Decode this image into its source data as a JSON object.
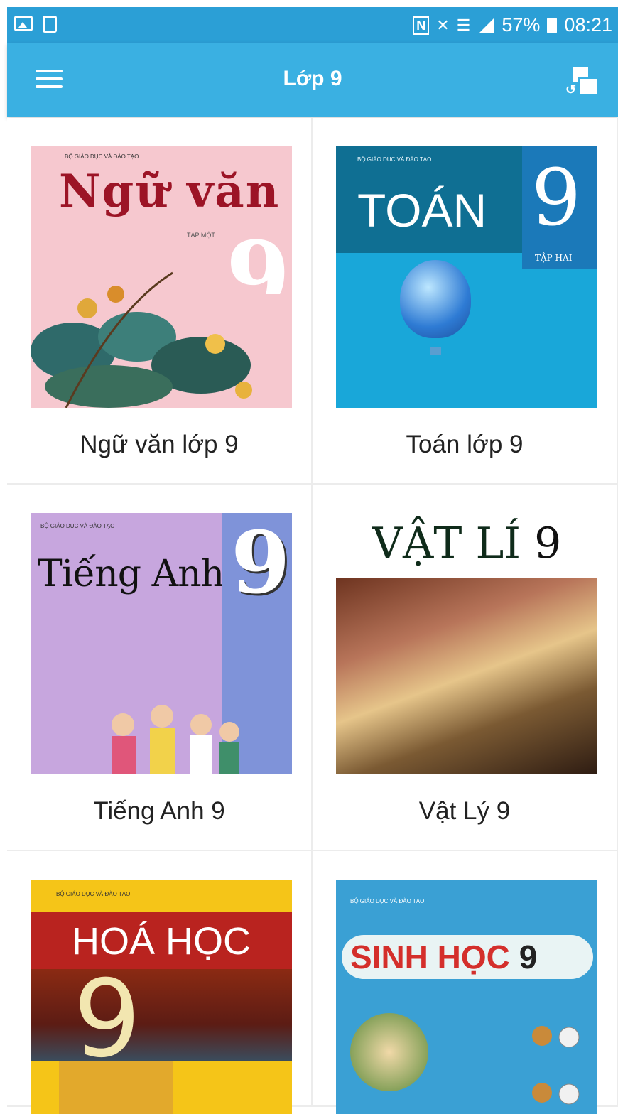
{
  "status_bar": {
    "nfc": "N",
    "battery": "57%",
    "time": "08:21",
    "icons": [
      "image-icon",
      "file-sync-icon",
      "nfc-icon",
      "mute-icon",
      "wifi-icon",
      "signal-icon",
      "battery-icon"
    ]
  },
  "app_bar": {
    "title": "Lớp 9",
    "menu_icon": "hamburger-menu-icon",
    "action_icon": "switch-class-icon"
  },
  "books": [
    {
      "caption": "Ngữ văn lớp 9",
      "cover": {
        "title": "Ngữ văn",
        "number": "9",
        "publisher": "BỘ GIÁO DỤC VÀ ĐÀO TẠO",
        "subtitle": "TẬP MỘT"
      }
    },
    {
      "caption": "Toán lớp 9",
      "cover": {
        "title": "TOÁN",
        "number": "9",
        "publisher": "BỘ GIÁO DỤC VÀ ĐÀO TẠO",
        "subtitle": "TẬP HAI"
      }
    },
    {
      "caption": "Tiếng Anh 9",
      "cover": {
        "title": "Tiếng Anh",
        "number": "9",
        "publisher": "BỘ GIÁO DỤC VÀ ĐÀO TẠO"
      }
    },
    {
      "caption": "Vật Lý 9",
      "cover": {
        "title": "VẬT LÍ",
        "number": "9"
      }
    },
    {
      "caption": "",
      "cover": {
        "title": "HOÁ HỌC",
        "number": "9",
        "publisher": "BỘ GIÁO DỤC VÀ ĐÀO TẠO"
      }
    },
    {
      "caption": "",
      "cover": {
        "title": "SINH HỌC",
        "number": "9",
        "publisher": "BỘ GIÁO DỤC VÀ ĐÀO TẠO"
      }
    }
  ],
  "colors": {
    "status_bar": "#2b9fd6",
    "app_bar": "#3ab0e2"
  }
}
